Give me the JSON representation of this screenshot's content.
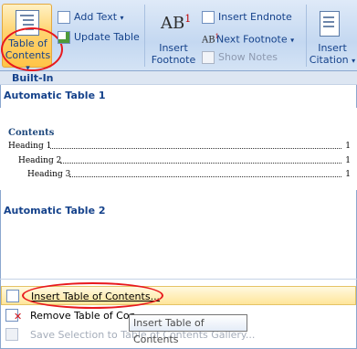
{
  "ribbon": {
    "toc_button": {
      "line1": "Table of",
      "line2": "Contents",
      "arrow": "▾"
    },
    "add_text": "Add Text",
    "update_table": "Update Table",
    "insert_footnote": {
      "line1": "Insert",
      "line2": "Footnote",
      "icon_text": "AB",
      "superscript": "1"
    },
    "insert_endnote": "Insert Endnote",
    "next_footnote": "Next Footnote",
    "show_notes": "Show Notes",
    "insert_citation": {
      "line1": "Insert",
      "line2": "Citation"
    },
    "next_footnote_icon_text": "AB",
    "next_footnote_sup": "1"
  },
  "gallery": {
    "section": "Built-In",
    "items": [
      {
        "title": "Automatic Table 1"
      },
      {
        "title": "Automatic Table 2"
      }
    ],
    "preview": {
      "heading": "Contents",
      "lines": [
        {
          "text": "Heading 1",
          "page": "1"
        },
        {
          "text": "Heading 2",
          "page": "1"
        },
        {
          "text": "Heading 3",
          "page": "1"
        }
      ]
    }
  },
  "menu": {
    "insert_toc": "Insert Table of Contents...",
    "remove_toc": "Remove Table of Con",
    "save_selection": "Save Selection to Table of Contents Gallery..."
  },
  "tooltip": "Insert Table of Contents",
  "colors": {
    "highlight": "#e8191e",
    "accent": "#15428b"
  }
}
